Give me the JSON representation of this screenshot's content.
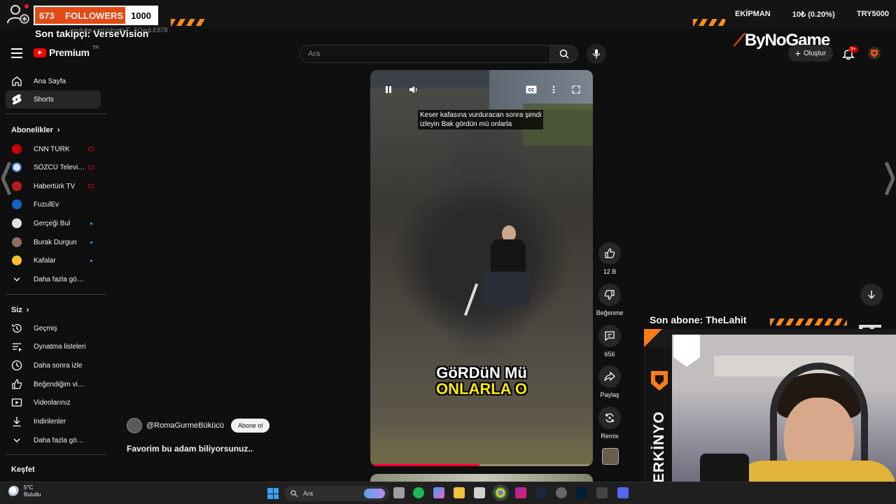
{
  "overlay": {
    "followers_current": "673",
    "followers_label": "FOLLOWERS",
    "followers_goal": "1000",
    "last_follower": "Son takipçi: VerseVision",
    "url_ghost": "youtube.com/shorts/F_5QaqLE878",
    "equipment_label": "EKİPMAN",
    "equipment_value": "10₺ (0.20%)",
    "equipment_code": "TRY5000",
    "sponsor": "ByNoGame",
    "last_subscriber": "Son abone: TheLahit",
    "streamer_name": "SERKİNYO"
  },
  "header": {
    "logo_text": "Premium",
    "logo_sup": "TR",
    "search_placeholder": "Ara",
    "create_label": "Oluştur",
    "notification_count": "9+"
  },
  "sidebar": {
    "main": [
      {
        "label": "Ana Sayfa",
        "icon": "home-icon"
      },
      {
        "label": "Shorts",
        "icon": "shorts-icon"
      }
    ],
    "subscriptions_title": "Abonelikler",
    "subscriptions": [
      {
        "label": "CNN TÜRK",
        "indicator": "live",
        "color": "#cc0000"
      },
      {
        "label": "SÖZCÜ Televizyo...",
        "indicator": "live",
        "color": "#2c7bd6"
      },
      {
        "label": "Habertürk TV",
        "indicator": "live",
        "color": "#b71c1c"
      },
      {
        "label": "FuzulEv",
        "indicator": "none",
        "color": "#1565c0"
      },
      {
        "label": "Gerçeği Bul",
        "indicator": "new",
        "color": "#e0e0e0"
      },
      {
        "label": "Burak Durgun",
        "indicator": "new",
        "color": "#8d6e63"
      },
      {
        "label": "Kafalar",
        "indicator": "new",
        "color": "#fbc02d"
      }
    ],
    "show_more_1": "Daha fazla göster",
    "you_title": "Siz",
    "you_items": [
      {
        "label": "Geçmiş",
        "icon": "history-icon"
      },
      {
        "label": "Oynatma listeleri",
        "icon": "playlist-icon"
      },
      {
        "label": "Daha sonra izle",
        "icon": "clock-icon"
      },
      {
        "label": "Beğendiğim videolar",
        "icon": "like-icon"
      },
      {
        "label": "Videolarınız",
        "icon": "video-icon"
      },
      {
        "label": "İndirilenler",
        "icon": "download-icon"
      }
    ],
    "show_more_2": "Daha fazla göster",
    "explore_title": "Keşfet"
  },
  "video": {
    "caption_top_1": "Keser kafasına vurduracan sonra şimdi",
    "caption_top_2": "izleyin Bak gördün mü onlarla",
    "caption_big_1": "GöRDüN Mü",
    "caption_big_2": "ONLARLA O",
    "progress": 0.49,
    "channel": "@RomaGurmeBükücü",
    "subscribe_label": "Abone ol",
    "title": "Favorim bu adam biliyorsunuz.."
  },
  "actions": {
    "likes": "12 B",
    "dislike_label": "Beğenme",
    "comments": "656",
    "share_label": "Paylaş",
    "remix_label": "Remix"
  },
  "taskbar": {
    "temperature": "5°C",
    "weather": "Bulutlu",
    "search_placeholder": "Ara"
  },
  "colors": {
    "accent": "#ff7a1a",
    "youtube_red": "#ff0000",
    "background": "#0f0f0f"
  }
}
